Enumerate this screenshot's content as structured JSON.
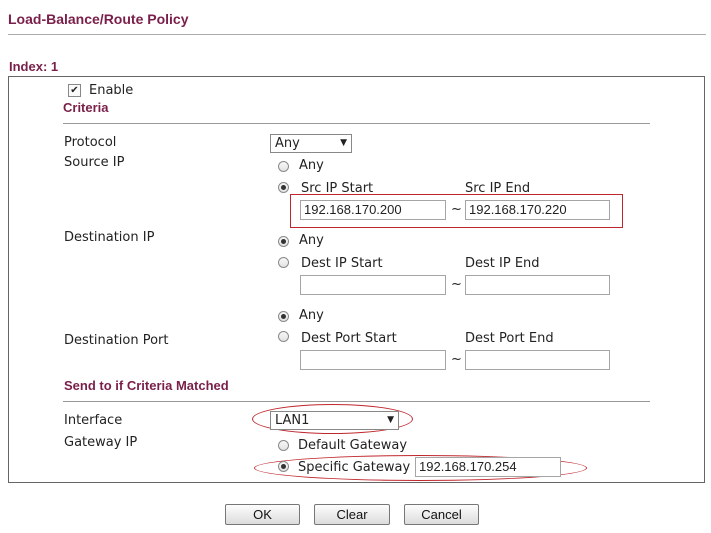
{
  "page": {
    "title": "Load-Balance/Route Policy",
    "index_label": "Index: 1"
  },
  "enable": {
    "label": "Enable",
    "checked": true
  },
  "criteria": {
    "title": "Criteria",
    "protocol": {
      "label": "Protocol",
      "selected": "Any"
    },
    "source_ip": {
      "label": "Source IP",
      "any_label": "Any",
      "range_label": "Src IP Start",
      "end_label": "Src IP End",
      "selected": "range",
      "start_value": "192.168.170.200",
      "end_value": "192.168.170.220"
    },
    "destination_ip": {
      "label": "Destination IP",
      "any_label": "Any",
      "range_label": "Dest IP Start",
      "end_label": "Dest IP End",
      "selected": "any",
      "start_value": "",
      "end_value": ""
    },
    "destination_port": {
      "label": "Destination Port",
      "any_label": "Any",
      "range_label": "Dest Port Start",
      "end_label": "Dest Port End",
      "selected": "any",
      "start_value": "",
      "end_value": ""
    },
    "tilde": "~"
  },
  "send_to": {
    "title": "Send to if Criteria Matched",
    "interface": {
      "label": "Interface",
      "selected": "LAN1"
    },
    "gateway_ip": {
      "label": "Gateway IP",
      "default_label": "Default Gateway",
      "specific_label": "Specific Gateway",
      "selected": "specific",
      "specific_value": "192.168.170.254"
    }
  },
  "buttons": {
    "ok": "OK",
    "clear": "Clear",
    "cancel": "Cancel"
  },
  "colors": {
    "title": "#7a1f4a",
    "highlight": "#c0272d"
  }
}
